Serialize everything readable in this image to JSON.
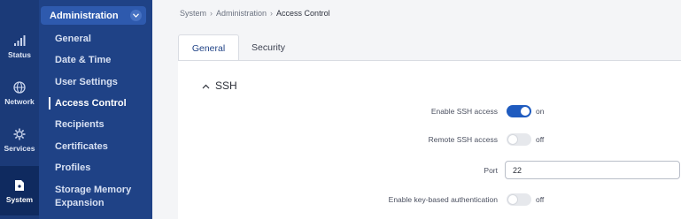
{
  "rail": [
    {
      "label": "Status",
      "icon": "signal-bars-icon"
    },
    {
      "label": "Network",
      "icon": "globe-icon"
    },
    {
      "label": "Services",
      "icon": "gear-icon"
    },
    {
      "label": "System",
      "icon": "file-icon",
      "active": true
    }
  ],
  "submenu": {
    "section": "Administration",
    "items": [
      "General",
      "Date & Time",
      "User Settings",
      "Access Control",
      "Recipients",
      "Certificates",
      "Profiles",
      "Storage Memory",
      "Expansion"
    ],
    "active": "Access Control"
  },
  "breadcrumb": [
    "System",
    "Administration",
    "Access Control"
  ],
  "tabs": [
    "General",
    "Security"
  ],
  "section_title": "SSH",
  "settings": {
    "enable_ssh": {
      "label": "Enable SSH access",
      "state": "on"
    },
    "remote_ssh": {
      "label": "Remote SSH access",
      "state": "off"
    },
    "port": {
      "label": "Port",
      "value": "22"
    },
    "key_auth": {
      "label": "Enable key-based authentication",
      "state": "off"
    }
  },
  "colors": {
    "accent": "#1f5bbf",
    "sidebar": "#1f4286",
    "rail": "#1b3a78"
  }
}
